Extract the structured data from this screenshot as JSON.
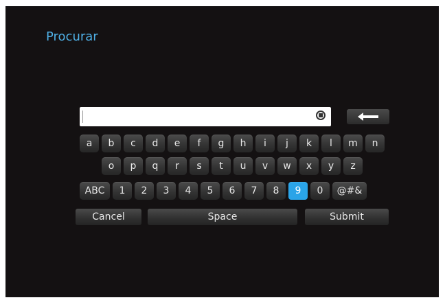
{
  "screen": {
    "title": "Procurar"
  },
  "search": {
    "value": "",
    "clear_icon": "clear-icon"
  },
  "keyboard": {
    "row1": [
      "a",
      "b",
      "c",
      "d",
      "e",
      "f",
      "g",
      "h",
      "i",
      "j",
      "k",
      "l",
      "m",
      "n"
    ],
    "row2": [
      "o",
      "p",
      "q",
      "r",
      "s",
      "t",
      "u",
      "v",
      "w",
      "x",
      "y",
      "z"
    ],
    "row3": [
      "ABC",
      "1",
      "2",
      "3",
      "4",
      "5",
      "6",
      "7",
      "8",
      "9",
      "0",
      "@#&"
    ],
    "selected_key": "9",
    "cancel_label": "Cancel",
    "space_label": "Space",
    "submit_label": "Submit",
    "backspace_icon": "backspace-arrow-icon"
  },
  "colors": {
    "accent": "#2aa4e8",
    "title": "#4fb0e6",
    "background": "#141112"
  }
}
